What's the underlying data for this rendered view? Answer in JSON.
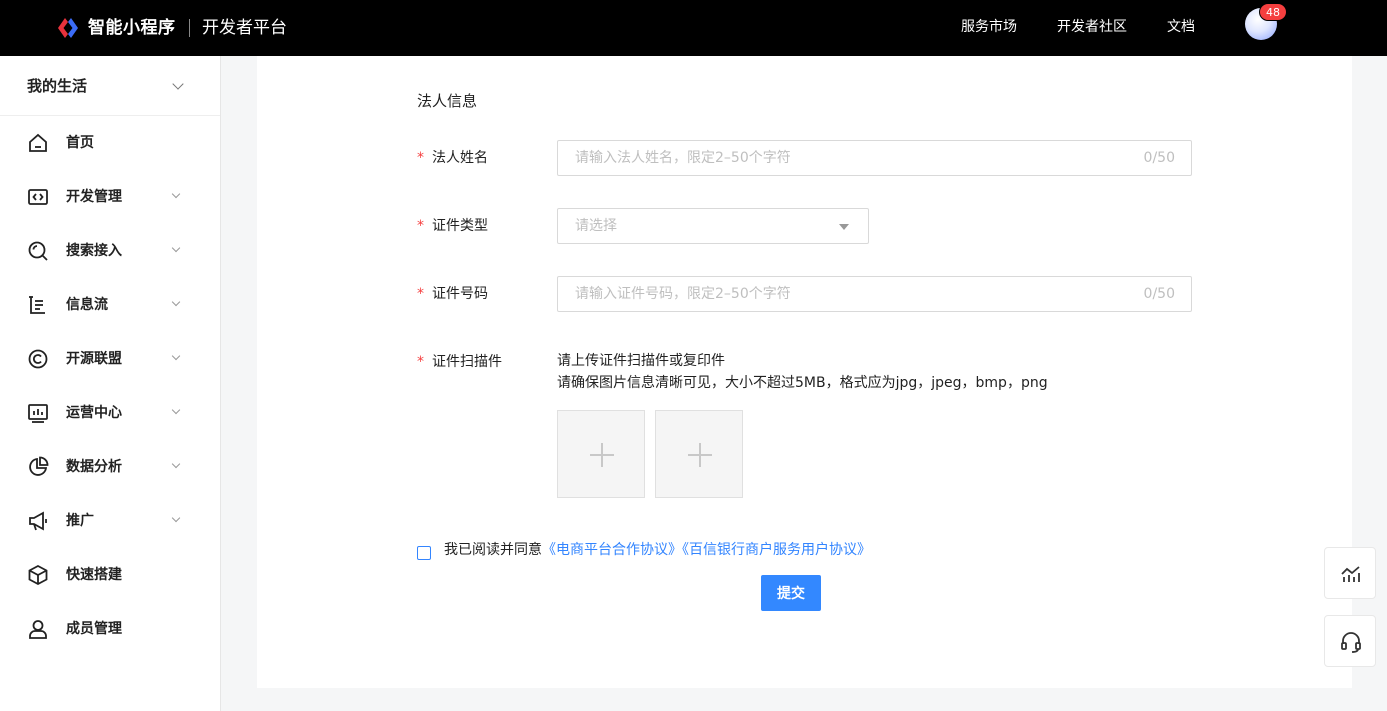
{
  "header": {
    "brand": "智能小程序",
    "platform": "开发者平台",
    "nav": [
      "服务市场",
      "开发者社区",
      "文档"
    ],
    "badge_count": "48",
    "logo_colors": [
      "#e8323c",
      "#3b6cf6"
    ]
  },
  "sidebar": {
    "app_name": "我的生活",
    "items": [
      {
        "label": "首页",
        "icon": "home-icon",
        "expandable": false
      },
      {
        "label": "开发管理",
        "icon": "code-icon",
        "expandable": true
      },
      {
        "label": "搜索接入",
        "icon": "search-icon",
        "expandable": true
      },
      {
        "label": "信息流",
        "icon": "feed-icon",
        "expandable": true
      },
      {
        "label": "开源联盟",
        "icon": "alliance-icon",
        "expandable": true
      },
      {
        "label": "运营中心",
        "icon": "operations-icon",
        "expandable": true
      },
      {
        "label": "数据分析",
        "icon": "pie-chart-icon",
        "expandable": true
      },
      {
        "label": "推广",
        "icon": "megaphone-icon",
        "expandable": true
      },
      {
        "label": "快速搭建",
        "icon": "cube-icon",
        "expandable": false
      },
      {
        "label": "成员管理",
        "icon": "user-icon",
        "expandable": false
      }
    ]
  },
  "form": {
    "section_title": "法人信息",
    "required_mark": "*",
    "name": {
      "label": "法人姓名",
      "placeholder": "请输入法人姓名，限定2–50个字符",
      "counter": "0/50"
    },
    "id_type": {
      "label": "证件类型",
      "placeholder": "请选择"
    },
    "id_number": {
      "label": "证件号码",
      "placeholder": "请输入证件号码，限定2–50个字符",
      "counter": "0/50"
    },
    "scan": {
      "label": "证件扫描件",
      "tip1": "请上传证件扫描件或复印件",
      "tip2": "请确保图片信息清晰可见，大小不超过5MB，格式应为jpg，jpeg，bmp，png"
    },
    "agreement": {
      "prefix": "我已阅读并同意",
      "link1": "《电商平台合作协议》",
      "link2": "《百信银行商户服务用户协议》"
    },
    "submit_label": "提交"
  },
  "colors": {
    "accent": "#3388ff",
    "required": "#f53f3f"
  }
}
